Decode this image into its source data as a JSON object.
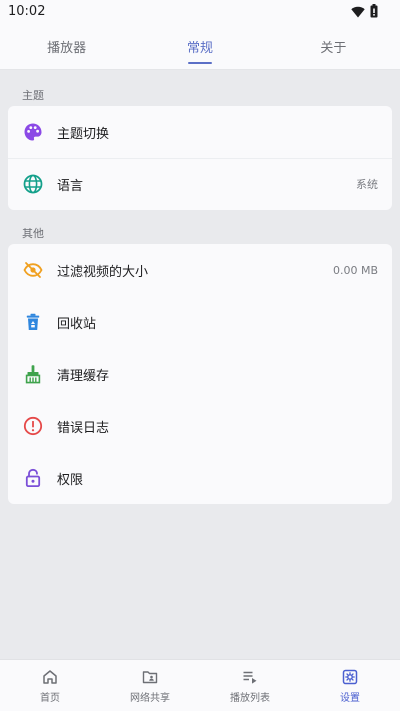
{
  "status_bar": {
    "time": "10:02"
  },
  "tabs": [
    {
      "label": "播放器"
    },
    {
      "label": "常规",
      "active": true
    },
    {
      "label": "关于"
    }
  ],
  "theme_section": {
    "header": "主题",
    "items": [
      {
        "label": "主题切换",
        "icon": "palette-icon"
      },
      {
        "label": "语言",
        "value": "系统",
        "icon": "globe-icon"
      }
    ]
  },
  "other_section": {
    "header": "其他",
    "items": [
      {
        "label": "过滤视频的大小",
        "value": "0.00 MB",
        "icon": "eye-off-icon"
      },
      {
        "label": "回收站",
        "icon": "recycle-bin-icon"
      },
      {
        "label": "清理缓存",
        "icon": "broom-icon"
      },
      {
        "label": "错误日志",
        "icon": "alert-circle-icon"
      },
      {
        "label": "权限",
        "icon": "lock-icon"
      }
    ]
  },
  "bottom_nav": [
    {
      "label": "首页",
      "icon": "home-icon"
    },
    {
      "label": "网络共享",
      "icon": "network-share-folder-icon"
    },
    {
      "label": "播放列表",
      "icon": "playlist-icon"
    },
    {
      "label": "设置",
      "icon": "settings-icon",
      "active": true
    }
  ],
  "colors": {
    "accent": "#5b6fc6",
    "palette_icon": "#8b49e6",
    "globe_icon": "#14a08b",
    "eye_off_icon": "#f0a020",
    "recycle_icon": "#2f86de",
    "broom_icon": "#3fa34d",
    "alert_icon": "#e54848",
    "lock_icon": "#7b4fd8"
  }
}
